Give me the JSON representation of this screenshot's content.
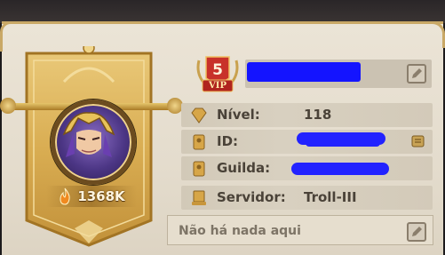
{
  "profile": {
    "power_value": "1368K",
    "vip": {
      "level": "5",
      "label": "VIP"
    },
    "rows": {
      "level": {
        "label": "Nível:",
        "value": "118"
      },
      "id": {
        "label": "ID:"
      },
      "guild": {
        "label": "Guilda:"
      },
      "server": {
        "label": "Servidor:",
        "value": "Troll-III"
      }
    },
    "status_text": "Não há nada aqui"
  },
  "colors": {
    "banner_gold": "#d9ad52",
    "panel_bg": "#e6dfd0",
    "text_dark": "#4a4238",
    "redaction": "#1a1aff"
  }
}
